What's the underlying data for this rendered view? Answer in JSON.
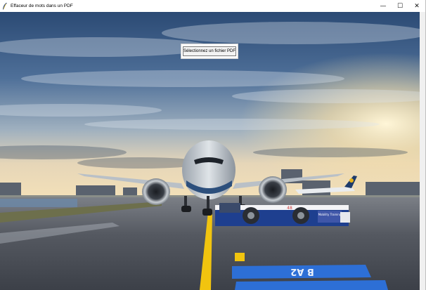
{
  "window": {
    "title": "Effaceur de mots dans un PDF",
    "controls": {
      "minimize": "—",
      "maximize": "☐",
      "close": "✕"
    }
  },
  "main": {
    "select_button_label": "Sélectionnez un fichier PDF"
  },
  "background": {
    "vehicle_text": "Mobility Training",
    "vehicle_number": "48",
    "ground_marking": "B A2"
  },
  "colors": {
    "sky_top": "#2f4f78",
    "sky_glow": "#f2d9a6",
    "tarmac": "#4b4f58",
    "taxi_line": "#f1c40f",
    "tug_blue": "#1e3f8f",
    "sign_blue": "#2d6fd6"
  }
}
